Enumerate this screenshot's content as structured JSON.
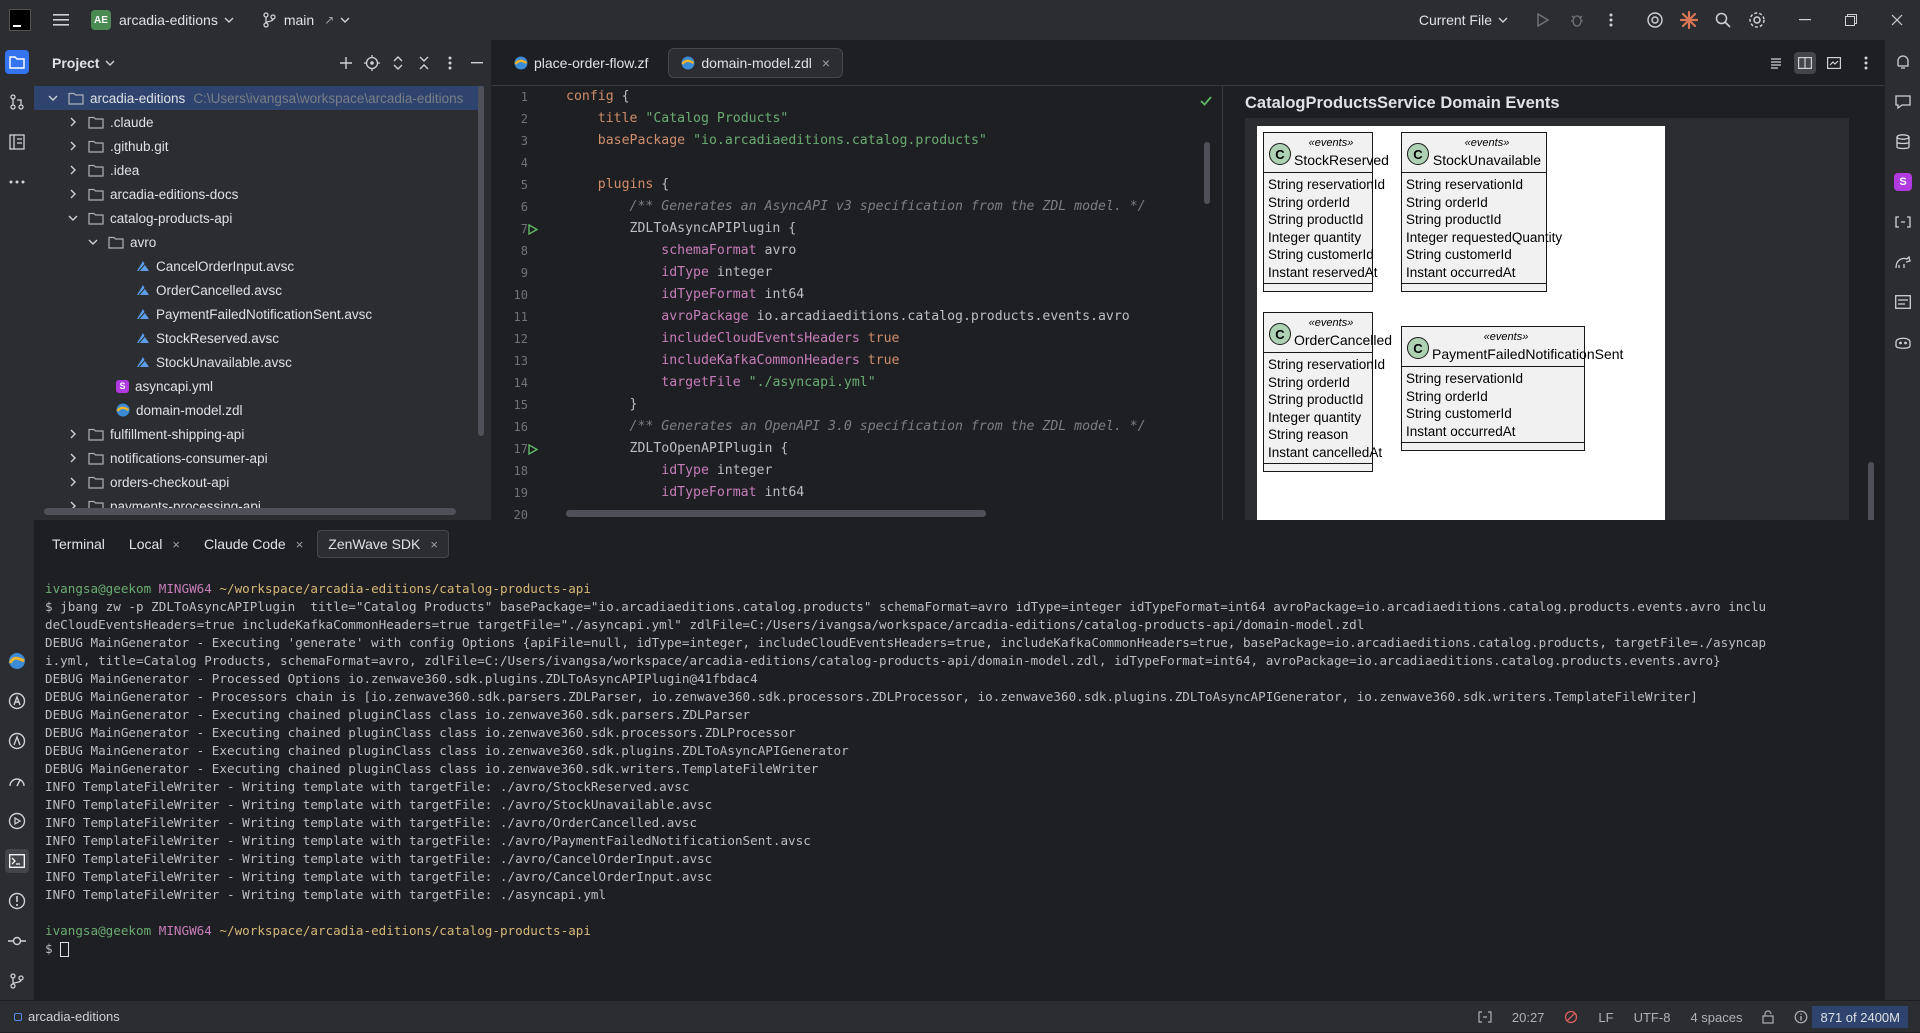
{
  "titlebar": {
    "project_badge": "AE",
    "project_name": "arcadia-editions",
    "branch": "main",
    "run_config": "Current File"
  },
  "project_panel": {
    "title": "Project",
    "tree": [
      {
        "name": "arcadia-editions",
        "hint": "C:\\Users\\ivangsa\\workspace\\arcadia-editions",
        "type": "folder",
        "depth": 0,
        "expanded": true,
        "selected": true
      },
      {
        "name": ".claude",
        "type": "folder",
        "depth": 1,
        "expanded": false
      },
      {
        "name": ".github.git",
        "type": "folder",
        "depth": 1,
        "expanded": false
      },
      {
        "name": ".idea",
        "type": "folder",
        "depth": 1,
        "expanded": false
      },
      {
        "name": "arcadia-editions-docs",
        "type": "folder",
        "depth": 1,
        "expanded": false
      },
      {
        "name": "catalog-products-api",
        "type": "folder",
        "depth": 1,
        "expanded": true
      },
      {
        "name": "avro",
        "type": "folder",
        "depth": 2,
        "expanded": true
      },
      {
        "name": "CancelOrderInput.avsc",
        "type": "avsc",
        "depth": 3
      },
      {
        "name": "OrderCancelled.avsc",
        "type": "avsc",
        "depth": 3
      },
      {
        "name": "PaymentFailedNotificationSent.avsc",
        "type": "avsc",
        "depth": 3
      },
      {
        "name": "StockReserved.avsc",
        "type": "avsc",
        "depth": 3
      },
      {
        "name": "StockUnavailable.avsc",
        "type": "avsc",
        "depth": 3
      },
      {
        "name": "asyncapi.yml",
        "type": "yml",
        "depth": 2
      },
      {
        "name": "domain-model.zdl",
        "type": "zdl",
        "depth": 2
      },
      {
        "name": "fulfillment-shipping-api",
        "type": "folder",
        "depth": 1,
        "expanded": false
      },
      {
        "name": "notifications-consumer-api",
        "type": "folder",
        "depth": 1,
        "expanded": false
      },
      {
        "name": "orders-checkout-api",
        "type": "folder",
        "depth": 1,
        "expanded": false
      },
      {
        "name": "payments-processing-api",
        "type": "folder",
        "depth": 1,
        "expanded": false
      }
    ]
  },
  "editor": {
    "tabs": [
      {
        "label": "place-order-flow.zf",
        "active": false
      },
      {
        "label": "domain-model.zdl",
        "active": true
      }
    ],
    "lines": [
      {
        "n": "1",
        "html": [
          [
            "kw",
            "config"
          ],
          [
            "",
            "{"
          ]
        ]
      },
      {
        "n": "2",
        "html": [
          [
            "",
            "    "
          ],
          [
            "kw",
            "title"
          ],
          [
            "",
            " "
          ],
          [
            "str",
            "\"Catalog Products\""
          ]
        ]
      },
      {
        "n": "3",
        "html": [
          [
            "",
            "    "
          ],
          [
            "kw",
            "basePackage"
          ],
          [
            "",
            " "
          ],
          [
            "str",
            "\"io.arcadiaeditions.catalog.products\""
          ]
        ]
      },
      {
        "n": "4",
        "html": [
          [
            "",
            ""
          ]
        ]
      },
      {
        "n": "5",
        "html": [
          [
            "",
            "    "
          ],
          [
            "kw",
            "plugins"
          ],
          [
            "",
            " {"
          ]
        ]
      },
      {
        "n": "6",
        "html": [
          [
            "",
            "        "
          ],
          [
            "cmt",
            "/** Generates an AsyncAPI v3 specification from the ZDL model. */"
          ]
        ]
      },
      {
        "n": "7",
        "html": [
          [
            "",
            "        ZDLToAsyncAPIPlugin {"
          ]
        ],
        "run": true
      },
      {
        "n": "8",
        "html": [
          [
            "",
            "            "
          ],
          [
            "prop",
            "schemaFormat"
          ],
          [
            "",
            " avro"
          ]
        ]
      },
      {
        "n": "9",
        "html": [
          [
            "",
            "            "
          ],
          [
            "prop",
            "idType"
          ],
          [
            "",
            " integer"
          ]
        ]
      },
      {
        "n": "10",
        "html": [
          [
            "",
            "            "
          ],
          [
            "prop",
            "idTypeFormat"
          ],
          [
            "",
            " int64"
          ]
        ]
      },
      {
        "n": "11",
        "html": [
          [
            "",
            "            "
          ],
          [
            "prop",
            "avroPackage"
          ],
          [
            "",
            " io.arcadiaeditions.catalog.products.events.avro"
          ]
        ]
      },
      {
        "n": "12",
        "html": [
          [
            "",
            "            "
          ],
          [
            "prop",
            "includeCloudEventsHeaders"
          ],
          [
            "",
            " "
          ],
          [
            "kw",
            "true"
          ]
        ]
      },
      {
        "n": "13",
        "html": [
          [
            "",
            "            "
          ],
          [
            "prop",
            "includeKafkaCommonHeaders"
          ],
          [
            "",
            " "
          ],
          [
            "kw",
            "true"
          ]
        ]
      },
      {
        "n": "14",
        "html": [
          [
            "",
            "            "
          ],
          [
            "prop",
            "targetFile"
          ],
          [
            "",
            " "
          ],
          [
            "str",
            "\"./asyncapi.yml\""
          ]
        ]
      },
      {
        "n": "15",
        "html": [
          [
            "",
            "        }"
          ]
        ]
      },
      {
        "n": "16",
        "html": [
          [
            "",
            "        "
          ],
          [
            "cmt",
            "/** Generates an OpenAPI 3.0 specification from the ZDL model. */"
          ]
        ]
      },
      {
        "n": "17",
        "html": [
          [
            "",
            "        ZDLToOpenAPIPlugin {"
          ]
        ],
        "run": true
      },
      {
        "n": "18",
        "html": [
          [
            "",
            "            "
          ],
          [
            "prop",
            "idType"
          ],
          [
            "",
            " integer"
          ]
        ]
      },
      {
        "n": "19",
        "html": [
          [
            "",
            "            "
          ],
          [
            "prop",
            "idTypeFormat"
          ],
          [
            "",
            " int64"
          ]
        ]
      },
      {
        "n": "20",
        "html": [
          [
            "",
            ""
          ]
        ]
      }
    ]
  },
  "preview": {
    "title": "CatalogProductsService Domain Events",
    "stereotype": "«events»",
    "classes": [
      {
        "name": "StockReserved",
        "fields": [
          "String reservationId",
          "String orderId",
          "String productId",
          "Integer quantity",
          "String customerId",
          "Instant reservedAt"
        ]
      },
      {
        "name": "StockUnavailable",
        "fields": [
          "String reservationId",
          "String orderId",
          "String productId",
          "Integer requestedQuantity",
          "String customerId",
          "Instant occurredAt"
        ]
      },
      {
        "name": "OrderCancelled",
        "fields": [
          "String reservationId",
          "String orderId",
          "String productId",
          "Integer quantity",
          "String reason",
          "Instant cancelledAt"
        ]
      },
      {
        "name": "PaymentFailedNotificationSent",
        "fields": [
          "String reservationId",
          "String orderId",
          "String customerId",
          "Instant occurredAt"
        ]
      }
    ]
  },
  "terminal": {
    "tabs": [
      {
        "label": "Terminal",
        "closable": false,
        "active": false
      },
      {
        "label": "Local",
        "closable": true,
        "active": false
      },
      {
        "label": "Claude Code",
        "closable": true,
        "active": false
      },
      {
        "label": "ZenWave SDK",
        "closable": true,
        "active": true
      }
    ],
    "prompt_user": "ivangsa@geekom",
    "prompt_shell": "MINGW64",
    "prompt_path": "~/workspace/arcadia-editions/catalog-products-api",
    "lines": [
      "$ jbang zw -p ZDLToAsyncAPIPlugin  title=\"Catalog Products\" basePackage=\"io.arcadiaeditions.catalog.products\" schemaFormat=avro idType=integer idTypeFormat=int64 avroPackage=io.arcadiaeditions.catalog.products.events.avro inclu",
      "deCloudEventsHeaders=true includeKafkaCommonHeaders=true targetFile=\"./asyncapi.yml\" zdlFile=C:/Users/ivangsa/workspace/arcadia-editions/catalog-products-api/domain-model.zdl",
      "DEBUG MainGenerator - Executing 'generate' with config Options {apiFile=null, idType=integer, includeCloudEventsHeaders=true, includeKafkaCommonHeaders=true, basePackage=io.arcadiaeditions.catalog.products, targetFile=./asyncap",
      "i.yml, title=Catalog Products, schemaFormat=avro, zdlFile=C:/Users/ivangsa/workspace/arcadia-editions/catalog-products-api/domain-model.zdl, idTypeFormat=int64, avroPackage=io.arcadiaeditions.catalog.products.events.avro}",
      "DEBUG MainGenerator - Processed Options io.zenwave360.sdk.plugins.ZDLToAsyncAPIPlugin@41fbdac4",
      "DEBUG MainGenerator - Processors chain is [io.zenwave360.sdk.parsers.ZDLParser, io.zenwave360.sdk.processors.ZDLProcessor, io.zenwave360.sdk.plugins.ZDLToAsyncAPIGenerator, io.zenwave360.sdk.writers.TemplateFileWriter]",
      "DEBUG MainGenerator - Executing chained pluginClass class io.zenwave360.sdk.parsers.ZDLParser",
      "DEBUG MainGenerator - Executing chained pluginClass class io.zenwave360.sdk.processors.ZDLProcessor",
      "DEBUG MainGenerator - Executing chained pluginClass class io.zenwave360.sdk.plugins.ZDLToAsyncAPIGenerator",
      "DEBUG MainGenerator - Executing chained pluginClass class io.zenwave360.sdk.writers.TemplateFileWriter",
      "INFO TemplateFileWriter - Writing template with targetFile: ./avro/StockReserved.avsc",
      "INFO TemplateFileWriter - Writing template with targetFile: ./avro/StockUnavailable.avsc",
      "INFO TemplateFileWriter - Writing template with targetFile: ./avro/OrderCancelled.avsc",
      "INFO TemplateFileWriter - Writing template with targetFile: ./avro/PaymentFailedNotificationSent.avsc",
      "INFO TemplateFileWriter - Writing template with targetFile: ./avro/CancelOrderInput.avsc",
      "INFO TemplateFileWriter - Writing template with targetFile: ./avro/CancelOrderInput.avsc",
      "INFO TemplateFileWriter - Writing template with targetFile: ./asyncapi.yml"
    ],
    "prompt_symbol": "$"
  },
  "statusbar": {
    "project": "arcadia-editions",
    "position": "20:27",
    "line_ending": "LF",
    "encoding": "UTF-8",
    "indent": "4 spaces",
    "memory": "871 of 2400M"
  },
  "colors": {
    "accent": "#3574f0",
    "selection": "#2e436e",
    "keyword": "#cf8e6d",
    "string": "#6aab73",
    "comment": "#7a7e85",
    "property": "#c77dbb",
    "uml_circle": "#add1b2"
  }
}
